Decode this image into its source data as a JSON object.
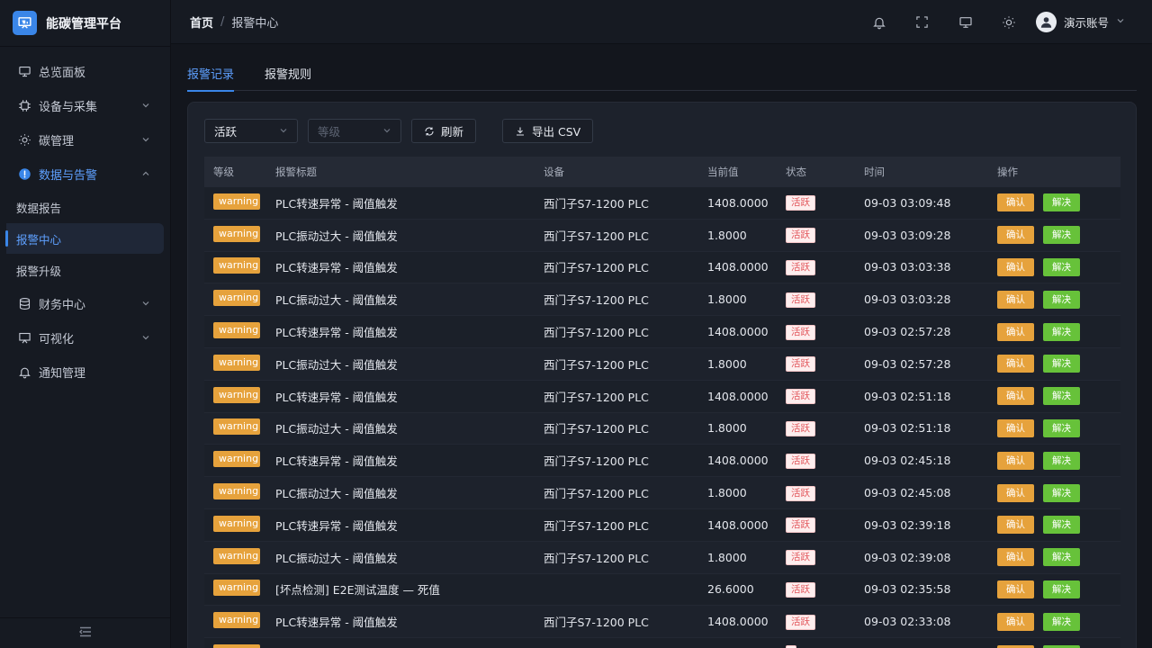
{
  "brand": {
    "title": "能碳管理平台",
    "accent": "#3a86e8"
  },
  "sidebar": {
    "items": [
      {
        "label": "总览面板",
        "icon": "monitor-icon",
        "has_children": false
      },
      {
        "label": "设备与采集",
        "icon": "chip-icon",
        "has_children": true
      },
      {
        "label": "碳管理",
        "icon": "sun-icon",
        "has_children": true
      },
      {
        "label": "数据与告警",
        "icon": "alert-icon",
        "has_children": true,
        "open": true,
        "children": [
          {
            "label": "数据报告"
          },
          {
            "label": "报警中心",
            "active": true
          },
          {
            "label": "报警升级"
          }
        ]
      },
      {
        "label": "财务中心",
        "icon": "database-icon",
        "has_children": true
      },
      {
        "label": "可视化",
        "icon": "presentation-icon",
        "has_children": true
      },
      {
        "label": "通知管理",
        "icon": "bell-icon",
        "has_children": false
      }
    ]
  },
  "header": {
    "breadcrumb_home": "首页",
    "breadcrumb_sep": "/",
    "breadcrumb_current": "报警中心",
    "user_name": "演示账号"
  },
  "tabs": [
    {
      "label": "报警记录",
      "active": true
    },
    {
      "label": "报警规则",
      "active": false
    }
  ],
  "filters": {
    "status_value": "活跃",
    "level_placeholder": "等级",
    "refresh_label": "刷新",
    "export_label": "导出 CSV"
  },
  "table": {
    "columns": [
      "等级",
      "报警标题",
      "设备",
      "当前值",
      "状态",
      "时间",
      "操作"
    ],
    "confirm_label": "确认",
    "resolve_label": "解决",
    "rows": [
      {
        "level": "warning",
        "title": "PLC转速异常 - 阈值触发",
        "device": "西门子S7-1200 PLC",
        "value": "1408.0000",
        "status": "活跃",
        "time": "09-03 03:09:48"
      },
      {
        "level": "warning",
        "title": "PLC振动过大 - 阈值触发",
        "device": "西门子S7-1200 PLC",
        "value": "1.8000",
        "status": "活跃",
        "time": "09-03 03:09:28"
      },
      {
        "level": "warning",
        "title": "PLC转速异常 - 阈值触发",
        "device": "西门子S7-1200 PLC",
        "value": "1408.0000",
        "status": "活跃",
        "time": "09-03 03:03:38"
      },
      {
        "level": "warning",
        "title": "PLC振动过大 - 阈值触发",
        "device": "西门子S7-1200 PLC",
        "value": "1.8000",
        "status": "活跃",
        "time": "09-03 03:03:28"
      },
      {
        "level": "warning",
        "title": "PLC转速异常 - 阈值触发",
        "device": "西门子S7-1200 PLC",
        "value": "1408.0000",
        "status": "活跃",
        "time": "09-03 02:57:28"
      },
      {
        "level": "warning",
        "title": "PLC振动过大 - 阈值触发",
        "device": "西门子S7-1200 PLC",
        "value": "1.8000",
        "status": "活跃",
        "time": "09-03 02:57:28"
      },
      {
        "level": "warning",
        "title": "PLC转速异常 - 阈值触发",
        "device": "西门子S7-1200 PLC",
        "value": "1408.0000",
        "status": "活跃",
        "time": "09-03 02:51:18"
      },
      {
        "level": "warning",
        "title": "PLC振动过大 - 阈值触发",
        "device": "西门子S7-1200 PLC",
        "value": "1.8000",
        "status": "活跃",
        "time": "09-03 02:51:18"
      },
      {
        "level": "warning",
        "title": "PLC转速异常 - 阈值触发",
        "device": "西门子S7-1200 PLC",
        "value": "1408.0000",
        "status": "活跃",
        "time": "09-03 02:45:18"
      },
      {
        "level": "warning",
        "title": "PLC振动过大 - 阈值触发",
        "device": "西门子S7-1200 PLC",
        "value": "1.8000",
        "status": "活跃",
        "time": "09-03 02:45:08"
      },
      {
        "level": "warning",
        "title": "PLC转速异常 - 阈值触发",
        "device": "西门子S7-1200 PLC",
        "value": "1408.0000",
        "status": "活跃",
        "time": "09-03 02:39:18"
      },
      {
        "level": "warning",
        "title": "PLC振动过大 - 阈值触发",
        "device": "西门子S7-1200 PLC",
        "value": "1.8000",
        "status": "活跃",
        "time": "09-03 02:39:08"
      },
      {
        "level": "warning",
        "title": "[坏点检测] E2E测试温度 — 死值",
        "device": "",
        "value": "26.6000",
        "status": "活跃",
        "time": "09-03 02:35:58"
      },
      {
        "level": "warning",
        "title": "PLC转速异常 - 阈值触发",
        "device": "西门子S7-1200 PLC",
        "value": "1408.0000",
        "status": "活跃",
        "time": "09-03 02:33:08"
      },
      {
        "level": "warning",
        "title": "",
        "device": "",
        "value": "",
        "status": "",
        "time": ""
      }
    ]
  }
}
